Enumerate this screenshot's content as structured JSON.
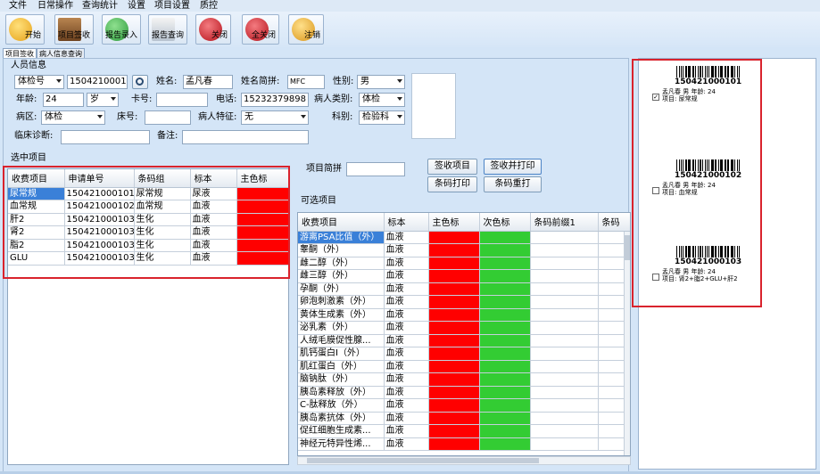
{
  "menu": [
    "文件",
    "日常操作",
    "查询统计",
    "设置",
    "项目设置",
    "质控"
  ],
  "toolbar": {
    "buttons": [
      {
        "label": "开始",
        "icon": "start-icon",
        "color": "#f0b429"
      },
      {
        "label": "项目签收",
        "icon": "sign-in-book-icon",
        "color": "#8a5a2b"
      },
      {
        "label": "报告录入",
        "icon": "report-entry-icon",
        "color": "#3aa54a"
      },
      {
        "label": "报告查询",
        "icon": "report-query-icon",
        "color": "#6c7b8c"
      },
      {
        "label": "关闭",
        "icon": "close-icon",
        "color": "#c8232c"
      },
      {
        "label": "全关闭",
        "icon": "close-all-icon",
        "color": "#c8232c"
      },
      {
        "label": "注销",
        "icon": "logout-icon",
        "color": "#e0a419"
      }
    ]
  },
  "tabs": [
    "项目签收",
    "病人信息查询"
  ],
  "person": {
    "section_title": "人员信息",
    "id_type": "体检号",
    "id_value": "1504210001",
    "name_label": "姓名:",
    "name": "孟凡春",
    "pinyin_label": "姓名简拼:",
    "pinyin": "MFC",
    "gender_label": "性别:",
    "gender": "男",
    "age_label": "年龄:",
    "age": "24",
    "age_unit": "岁",
    "card_label": "卡号:",
    "card": "",
    "phone_label": "电话:",
    "phone": "15232379898",
    "patient_type_label": "病人类别:",
    "patient_type": "体检",
    "ward_label": "病区:",
    "ward": "体检",
    "bed_label": "床号:",
    "bed": "",
    "feature_label": "病人特征:",
    "feature": "无",
    "dept_label": "科别:",
    "dept": "检验科",
    "diagnosis_label": "临床诊断:",
    "diagnosis": "",
    "remark_label": "备注:",
    "remark": ""
  },
  "selected": {
    "title": "选中项目",
    "columns": [
      "收费项目",
      "申请单号",
      "条码组",
      "标本",
      "主色标"
    ],
    "rows": [
      [
        "尿常规",
        "150421000101",
        "尿常规",
        "尿液",
        ""
      ],
      [
        "血常规",
        "150421000102",
        "血常规",
        "血液",
        ""
      ],
      [
        "肝2",
        "150421000103",
        "生化",
        "血液",
        ""
      ],
      [
        "肾2",
        "150421000103",
        "生化",
        "血液",
        ""
      ],
      [
        "脂2",
        "150421000103",
        "生化",
        "血液",
        ""
      ],
      [
        "GLU",
        "150421000103",
        "生化",
        "血液",
        ""
      ]
    ],
    "color_main": "#ff0000"
  },
  "actions": {
    "short_label": "项目简拼",
    "short_value": "",
    "sign": "签收项目",
    "sign_print": "签收并打印",
    "print": "条码打印",
    "reprint": "条码重打"
  },
  "available": {
    "title": "可选项目",
    "columns": [
      "收费项目",
      "标本",
      "主色标",
      "次色标",
      "条码前缀1",
      "条码"
    ],
    "rows": [
      [
        "游离PSA比值（外）",
        "血液"
      ],
      [
        "睾酮（外）",
        "血液"
      ],
      [
        "雌二醇（外）",
        "血液"
      ],
      [
        "雌三醇（外）",
        "血液"
      ],
      [
        "孕酮（外）",
        "血液"
      ],
      [
        "卵泡刺激素（外）",
        "血液"
      ],
      [
        "黄体生成素（外）",
        "血液"
      ],
      [
        "泌乳素（外）",
        "血液"
      ],
      [
        "人绒毛膜促性腺...",
        "血液"
      ],
      [
        "肌钙蛋白I（外）",
        "血液"
      ],
      [
        "肌红蛋白（外）",
        "血液"
      ],
      [
        "脑钠肽（外）",
        "血液"
      ],
      [
        "胰岛素释放（外）",
        "血液"
      ],
      [
        "C-肽释放（外）",
        "血液"
      ],
      [
        "胰岛素抗体（外）",
        "血液"
      ],
      [
        "促红细胞生成素...",
        "血液"
      ],
      [
        "神经元特异性烯...",
        "血液"
      ]
    ],
    "color_main": "#ff0000",
    "color_secondary": "#33cc33"
  },
  "labels": [
    {
      "number": "150421000101",
      "line1": "孟凡春 男 年龄: 24",
      "line2": "项目: 尿常规",
      "checked": true
    },
    {
      "number": "150421000102",
      "line1": "孟凡春 男 年龄: 24",
      "line2": "项目: 血常规",
      "checked": false
    },
    {
      "number": "150421000103",
      "line1": "孟凡春 男 年龄: 24",
      "line2": "项目: 肾2+脂2+GLU+肝2",
      "checked": false
    }
  ],
  "colors": {
    "highlight": "#d9232d",
    "selection": "#3a80d8"
  }
}
